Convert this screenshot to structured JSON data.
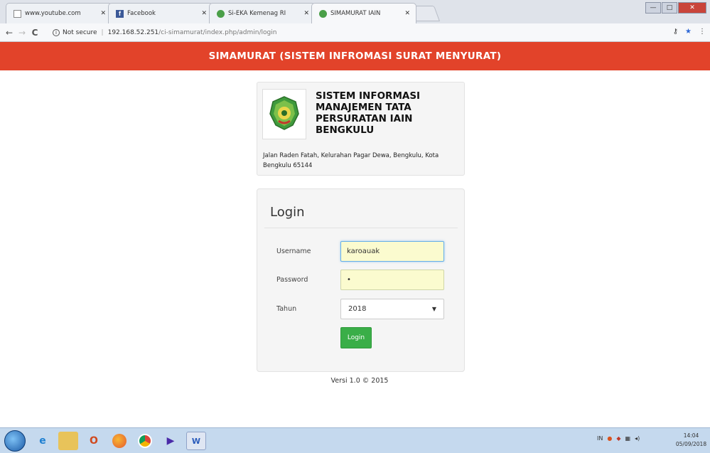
{
  "browser": {
    "tabs": [
      {
        "label": "www.youtube.com",
        "icon": "page-icon"
      },
      {
        "label": "Facebook",
        "icon": "facebook-icon"
      },
      {
        "label": "Si-EKA Kemenag RI",
        "icon": "green-emblem-icon"
      },
      {
        "label": "SIMAMURAT IAIN",
        "icon": "green-emblem-icon"
      }
    ],
    "security_label": "Not secure",
    "url_host": "192.168.52.251",
    "url_path": "/ci-simamurat/index.php/admin/login"
  },
  "header": {
    "title": "SIMAMURAT (SISTEM INFROMASI SURAT MENYURAT)",
    "background": "#e2432a"
  },
  "institution": {
    "title": "SISTEM INFORMASI MANAJEMEN TATA PERSURATAN IAIN BENGKULU",
    "address": "Jalan Raden Fatah, Kelurahan Pagar Dewa, Bengkulu, Kota Bengkulu 65144"
  },
  "login": {
    "heading": "Login",
    "username_label": "Username",
    "username_value": "karoauak",
    "password_label": "Password",
    "password_value": "•",
    "year_label": "Tahun",
    "year_value": "2018",
    "button_label": "Login",
    "button_color": "#3aae48"
  },
  "footer": {
    "version": "Versi 1.0 © 2015"
  },
  "taskbar": {
    "tray_lang": "IN",
    "time": "14:04",
    "date": "05/09/2018"
  }
}
